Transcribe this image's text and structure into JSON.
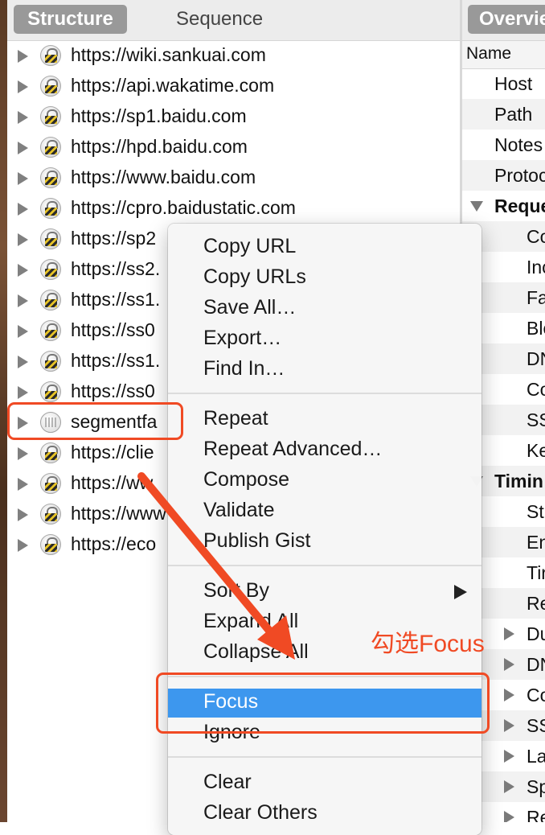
{
  "tabs": {
    "structure": "Structure",
    "sequence": "Sequence",
    "overview": "Overview"
  },
  "hosts": [
    {
      "label": "https://wiki.sankuai.com",
      "icon": "lock-icon"
    },
    {
      "label": "https://api.wakatime.com",
      "icon": "lock-icon"
    },
    {
      "label": "https://sp1.baidu.com",
      "icon": "lock-icon"
    },
    {
      "label": "https://hpd.baidu.com",
      "icon": "lock-icon"
    },
    {
      "label": "https://www.baidu.com",
      "icon": "lock-icon"
    },
    {
      "label": "https://cpro.baidustatic.com",
      "icon": "lock-icon"
    },
    {
      "label": "https://sp2",
      "icon": "lock-icon"
    },
    {
      "label": "https://ss2.",
      "icon": "lock-icon"
    },
    {
      "label": "https://ss1.",
      "icon": "lock-icon"
    },
    {
      "label": "https://ss0",
      "icon": "lock-icon"
    },
    {
      "label": "https://ss1.",
      "icon": "lock-icon"
    },
    {
      "label": "https://ss0",
      "icon": "lock-icon"
    },
    {
      "label": "segmentfa",
      "icon": "globe-icon"
    },
    {
      "label": "https://clie",
      "icon": "lock-icon"
    },
    {
      "label": "https://ww",
      "icon": "lock-icon"
    },
    {
      "label": "https://www",
      "icon": "lock-icon"
    },
    {
      "label": "https://eco",
      "icon": "lock-icon"
    }
  ],
  "overview": {
    "column_header": "Name",
    "rows": [
      {
        "label": "Host"
      },
      {
        "label": "Path"
      },
      {
        "label": "Notes"
      },
      {
        "label": "Protoc"
      },
      {
        "label": "Reque"
      },
      {
        "label": "Co"
      },
      {
        "label": "Inc"
      },
      {
        "label": "Fa"
      },
      {
        "label": "Blo"
      },
      {
        "label": "DN"
      },
      {
        "label": "Co"
      },
      {
        "label": "SS"
      },
      {
        "label": "Ke"
      },
      {
        "label": "Timin"
      },
      {
        "label": "St"
      },
      {
        "label": "En"
      },
      {
        "label": "Tir"
      },
      {
        "label": "Re"
      },
      {
        "label": "Du"
      },
      {
        "label": "DN"
      },
      {
        "label": "Co"
      },
      {
        "label": "SS"
      },
      {
        "label": "La"
      },
      {
        "label": "Sp"
      },
      {
        "label": "Re"
      }
    ]
  },
  "context_menu": {
    "copy_url": "Copy URL",
    "copy_urls": "Copy URLs",
    "save_all": "Save All…",
    "export": "Export…",
    "find_in": "Find In…",
    "repeat": "Repeat",
    "repeat_advanced": "Repeat Advanced…",
    "compose": "Compose",
    "validate": "Validate",
    "publish_gist": "Publish Gist",
    "sort_by": "Sort By",
    "expand_all": "Expand All",
    "collapse_all": "Collapse All",
    "focus": "Focus",
    "ignore": "Ignore",
    "clear": "Clear",
    "clear_others": "Clear Others"
  },
  "annotation": {
    "text": "勾选Focus",
    "color": "#f04a24"
  },
  "colors": {
    "highlight": "#3d97ee",
    "tab_active": "#999999"
  }
}
